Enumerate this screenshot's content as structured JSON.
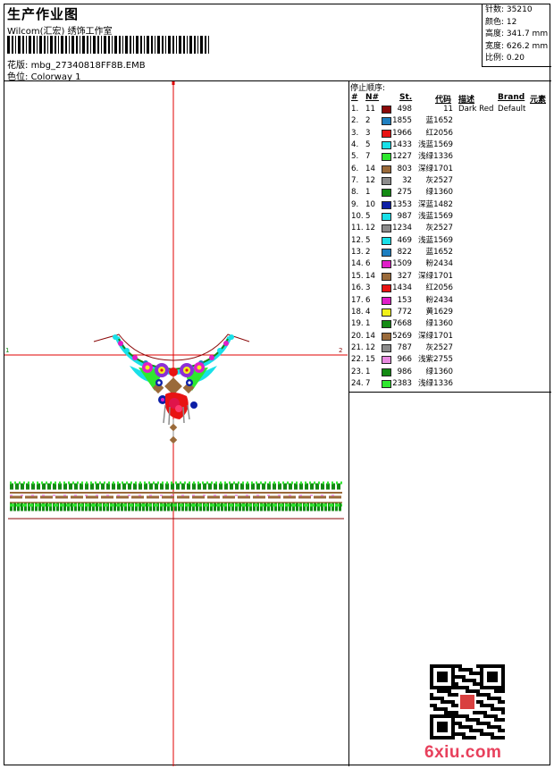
{
  "header": {
    "title": "生产作业图",
    "subtitle": "Wilcom(汇宏) 绣饰工作室",
    "design_label": "花版:",
    "design_file": "mbg_27340818FF8B.EMB",
    "colorway_label": "色位:",
    "colorway": "Colorway 1"
  },
  "specs": [
    {
      "label": "针数:",
      "value": "35210"
    },
    {
      "label": "颜色:",
      "value": "12"
    },
    {
      "label": "高度:",
      "value": "341.7 mm"
    },
    {
      "label": "宽度:",
      "value": "626.2 mm"
    },
    {
      "label": "比例:",
      "value": "0.20"
    }
  ],
  "stop_sequence": {
    "title": "停止顺序:",
    "headers": {
      "num": "#",
      "needle": "N#",
      "stitches": "St.",
      "code": "代码",
      "desc": "描述",
      "brand": "Brand",
      "element": "元素"
    },
    "rows": [
      {
        "n": "1.",
        "needle": "11",
        "color": "#8b0a0a",
        "st": "498",
        "code": "11",
        "desc": "Dark Red",
        "brand": "Default"
      },
      {
        "n": "2.",
        "needle": "2",
        "color": "#1e7fc0",
        "st": "1855",
        "code": "蓝1652",
        "desc": "",
        "brand": ""
      },
      {
        "n": "3.",
        "needle": "3",
        "color": "#e81313",
        "st": "1966",
        "code": "红2056",
        "desc": "",
        "brand": ""
      },
      {
        "n": "4.",
        "needle": "5",
        "color": "#19e0e8",
        "st": "1433",
        "code": "浅蓝1569",
        "desc": "",
        "brand": ""
      },
      {
        "n": "5.",
        "needle": "7",
        "color": "#2ee82e",
        "st": "1227",
        "code": "浅绿1336",
        "desc": "",
        "brand": ""
      },
      {
        "n": "6.",
        "needle": "14",
        "color": "#9a6a3a",
        "st": "803",
        "code": "深绿1701",
        "desc": "",
        "brand": ""
      },
      {
        "n": "7.",
        "needle": "12",
        "color": "#8c8c8c",
        "st": "32",
        "code": "灰2527",
        "desc": "",
        "brand": ""
      },
      {
        "n": "8.",
        "needle": "1",
        "color": "#148a14",
        "st": "275",
        "code": "绿1360",
        "desc": "",
        "brand": ""
      },
      {
        "n": "9.",
        "needle": "10",
        "color": "#0d1fa6",
        "st": "1353",
        "code": "深蓝1482",
        "desc": "",
        "brand": ""
      },
      {
        "n": "10.",
        "needle": "5",
        "color": "#19e0e8",
        "st": "987",
        "code": "浅蓝1569",
        "desc": "",
        "brand": ""
      },
      {
        "n": "11.",
        "needle": "12",
        "color": "#8c8c8c",
        "st": "1234",
        "code": "灰2527",
        "desc": "",
        "brand": ""
      },
      {
        "n": "12.",
        "needle": "5",
        "color": "#19e0e8",
        "st": "469",
        "code": "浅蓝1569",
        "desc": "",
        "brand": ""
      },
      {
        "n": "13.",
        "needle": "2",
        "color": "#1e7fc0",
        "st": "822",
        "code": "蓝1652",
        "desc": "",
        "brand": ""
      },
      {
        "n": "14.",
        "needle": "6",
        "color": "#e01ec8",
        "st": "1509",
        "code": "粉2434",
        "desc": "",
        "brand": ""
      },
      {
        "n": "15.",
        "needle": "14",
        "color": "#9a6a3a",
        "st": "327",
        "code": "深绿1701",
        "desc": "",
        "brand": ""
      },
      {
        "n": "16.",
        "needle": "3",
        "color": "#e81313",
        "st": "1434",
        "code": "红2056",
        "desc": "",
        "brand": ""
      },
      {
        "n": "17.",
        "needle": "6",
        "color": "#e01ec8",
        "st": "153",
        "code": "粉2434",
        "desc": "",
        "brand": ""
      },
      {
        "n": "18.",
        "needle": "4",
        "color": "#f2f21a",
        "st": "772",
        "code": "黄1629",
        "desc": "",
        "brand": ""
      },
      {
        "n": "19.",
        "needle": "1",
        "color": "#148a14",
        "st": "7668",
        "code": "绿1360",
        "desc": "",
        "brand": ""
      },
      {
        "n": "20.",
        "needle": "14",
        "color": "#9a6a3a",
        "st": "5269",
        "code": "深绿1701",
        "desc": "",
        "brand": ""
      },
      {
        "n": "21.",
        "needle": "12",
        "color": "#8c8c8c",
        "st": "787",
        "code": "灰2527",
        "desc": "",
        "brand": ""
      },
      {
        "n": "22.",
        "needle": "15",
        "color": "#e88ae0",
        "st": "966",
        "code": "浅紫2755",
        "desc": "",
        "brand": ""
      },
      {
        "n": "23.",
        "needle": "1",
        "color": "#148a14",
        "st": "986",
        "code": "绿1360",
        "desc": "",
        "brand": ""
      },
      {
        "n": "24.",
        "needle": "7",
        "color": "#2ee82e",
        "st": "2383",
        "code": "浅绿1336",
        "desc": "",
        "brand": ""
      }
    ]
  },
  "watermark": "6xiu.com",
  "colors": {
    "guide_line": "#e00000",
    "watermark": "#e8405c"
  }
}
